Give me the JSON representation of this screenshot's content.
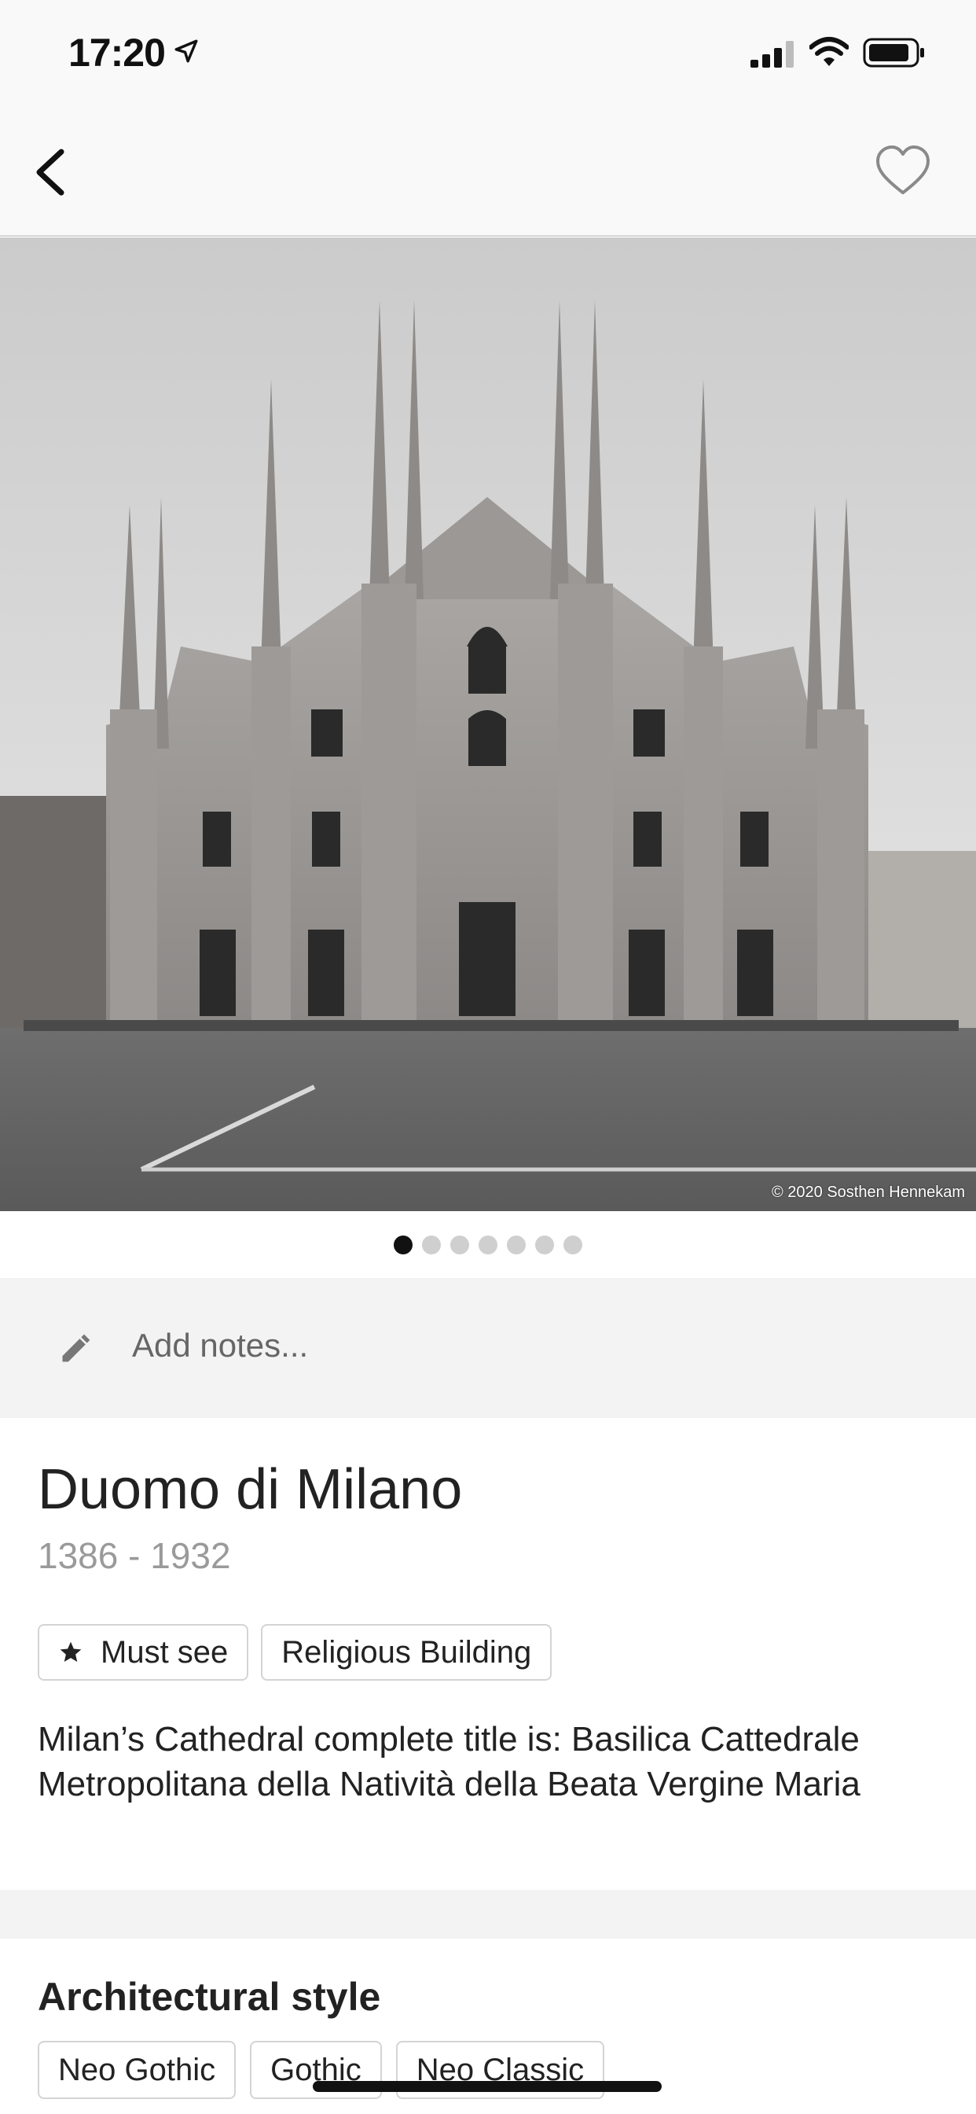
{
  "status_bar": {
    "time": "17:20",
    "icons": [
      "location-arrow-icon",
      "cellular-signal-icon",
      "wifi-icon",
      "battery-icon"
    ]
  },
  "nav": {
    "back_icon": "chevron-left-icon",
    "favorite_icon": "heart-outline-icon"
  },
  "hero": {
    "credit": "© 2020 Sosthen Hennekam",
    "page_count": 7,
    "current_page": 1
  },
  "notes": {
    "icon": "pencil-icon",
    "placeholder": "Add notes..."
  },
  "landmark": {
    "title": "Duomo di Milano",
    "years": "1386 - 1932",
    "tags": [
      {
        "label": "Must see",
        "icon": "star-icon"
      },
      {
        "label": "Religious Building"
      }
    ],
    "description": "Milan’s Cathedral complete title is: Basilica Cattedrale Metropolitana della Natività della Beata Vergine Maria"
  },
  "architectural_style": {
    "heading": "Architectural style",
    "tags": [
      "Neo Gothic",
      "Gothic",
      "Neo Classic"
    ]
  },
  "colors": {
    "background": "#ffffff",
    "bar_background": "#f9f9f9",
    "notes_background": "#f3f3f3",
    "text": "#222222",
    "muted_text": "#9a9a9a",
    "active_dot": "#111111",
    "inactive_dot": "#cfcfcf"
  }
}
